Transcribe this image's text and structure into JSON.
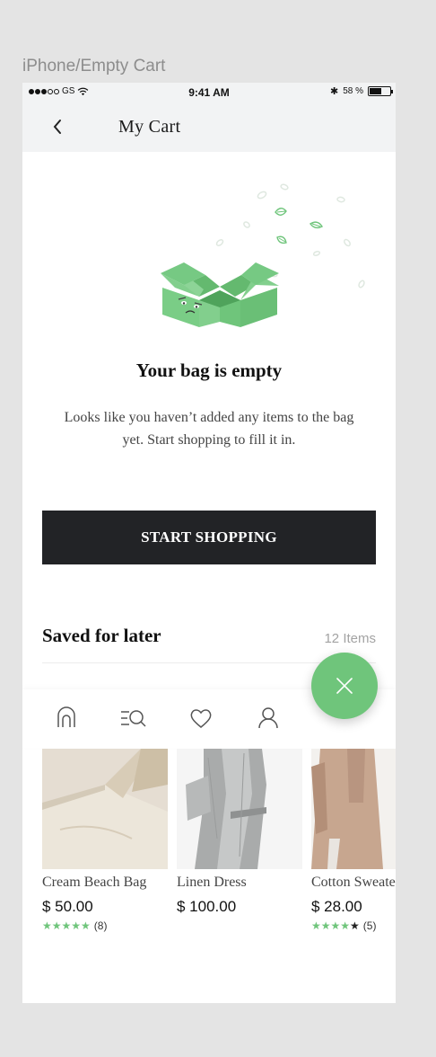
{
  "artboard": {
    "label": "iPhone/Empty Cart"
  },
  "status_bar": {
    "carrier": "GS",
    "time": "9:41 AM",
    "battery": "58 %"
  },
  "nav": {
    "title": "My Cart",
    "back_icon": "chevron-left-icon"
  },
  "empty_state": {
    "title": "Your bag is empty",
    "description": "Looks like you haven’t added any items to the bag yet. Start shopping to fill it in.",
    "illustration": "sad-open-box"
  },
  "cta": {
    "label": "START SHOPPING"
  },
  "saved": {
    "title": "Saved for later",
    "count": "12 Items"
  },
  "tabs": [
    {
      "icon": "home-icon"
    },
    {
      "icon": "search-menu-icon"
    },
    {
      "icon": "heart-icon"
    },
    {
      "icon": "user-icon"
    }
  ],
  "fab": {
    "icon": "close-icon"
  },
  "products": [
    {
      "name": "Cream Beach Bag",
      "price": "$ 50.00",
      "rating_stars": 5,
      "reviews": "(8)"
    },
    {
      "name": "Linen Dress",
      "price": "$ 100.00",
      "rating_stars": null,
      "reviews": ""
    },
    {
      "name": "Cotton Sweater",
      "price": "$ 28.00",
      "rating_stars": 4,
      "reviews": "(5)"
    }
  ],
  "colors": {
    "accent": "#6fc57b",
    "cta": "#222326",
    "bar_bg": "#f2f3f4",
    "canvas": "#e4e4e4"
  }
}
